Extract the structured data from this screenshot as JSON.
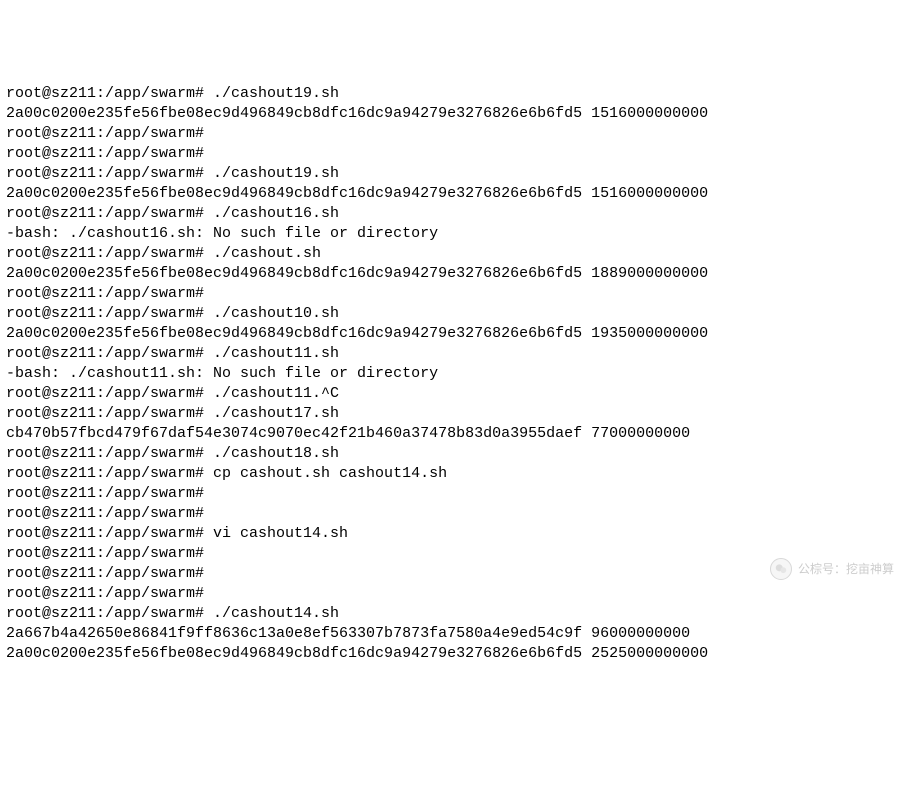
{
  "prompt": "root@sz211:/app/swarm#",
  "lines": [
    {
      "type": "cmd",
      "text": "./cashout19.sh"
    },
    {
      "type": "out",
      "text": "2a00c0200e235fe56fbe08ec9d496849cb8dfc16dc9a94279e3276826e6b6fd5 1516000000000"
    },
    {
      "type": "cmd",
      "text": ""
    },
    {
      "type": "cmd",
      "text": ""
    },
    {
      "type": "cmd",
      "text": "./cashout19.sh"
    },
    {
      "type": "out",
      "text": "2a00c0200e235fe56fbe08ec9d496849cb8dfc16dc9a94279e3276826e6b6fd5 1516000000000"
    },
    {
      "type": "cmd",
      "text": "./cashout16.sh"
    },
    {
      "type": "out",
      "text": "-bash: ./cashout16.sh: No such file or directory"
    },
    {
      "type": "cmd",
      "text": "./cashout.sh"
    },
    {
      "type": "out",
      "text": "2a00c0200e235fe56fbe08ec9d496849cb8dfc16dc9a94279e3276826e6b6fd5 1889000000000"
    },
    {
      "type": "cmd",
      "text": ""
    },
    {
      "type": "cmd",
      "text": "./cashout10.sh"
    },
    {
      "type": "out",
      "text": "2a00c0200e235fe56fbe08ec9d496849cb8dfc16dc9a94279e3276826e6b6fd5 1935000000000"
    },
    {
      "type": "cmd",
      "text": "./cashout11.sh"
    },
    {
      "type": "out",
      "text": "-bash: ./cashout11.sh: No such file or directory"
    },
    {
      "type": "cmd",
      "text": "./cashout11.^C"
    },
    {
      "type": "cmd",
      "text": "./cashout17.sh"
    },
    {
      "type": "out",
      "text": "cb470b57fbcd479f67daf54e3074c9070ec42f21b460a37478b83d0a3955daef 77000000000"
    },
    {
      "type": "cmd",
      "text": "./cashout18.sh"
    },
    {
      "type": "cmd",
      "text": "cp cashout.sh cashout14.sh"
    },
    {
      "type": "cmd",
      "text": ""
    },
    {
      "type": "cmd",
      "text": ""
    },
    {
      "type": "cmd",
      "text": "vi cashout14.sh"
    },
    {
      "type": "cmd",
      "text": ""
    },
    {
      "type": "cmd",
      "text": ""
    },
    {
      "type": "cmd",
      "text": ""
    },
    {
      "type": "cmd",
      "text": "./cashout14.sh"
    },
    {
      "type": "out",
      "text": "2a667b4a42650e86841f9ff8636c13a0e8ef563307b7873fa7580a4e9ed54c9f 96000000000"
    },
    {
      "type": "out",
      "text": "2a00c0200e235fe56fbe08ec9d496849cb8dfc16dc9a94279e3276826e6b6fd5 2525000000000"
    }
  ],
  "watermark": {
    "label": "公棕号：挖亩神算"
  }
}
